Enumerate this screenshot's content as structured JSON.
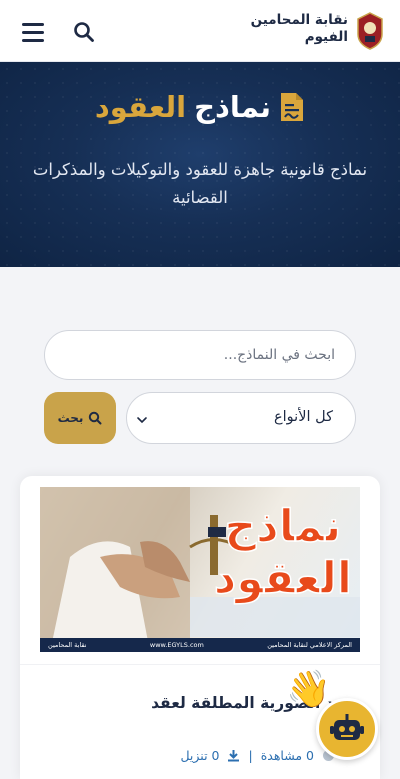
{
  "header": {
    "brand_line1": "نقابة المحامين",
    "brand_line2": "الفيوم"
  },
  "hero": {
    "title_white": "نماذج",
    "title_gold": "العقود",
    "subtitle": "نماذج قانونية جاهزة للعقود والتوكيلات والمذكرات القضائية"
  },
  "search": {
    "placeholder": "ابحث في النماذج...",
    "type_selected": "كل الأنواع",
    "button_label": "بحث"
  },
  "card": {
    "image_title_line1": "نماذج",
    "image_title_line2": "العقود",
    "image_footer_left": "نقابة المحامين",
    "image_footer_center": "www.EGYLS.com",
    "image_footer_right": "المركز الاعلامي لنقابة المحامين",
    "title": "تفيد الصورية المطلقة لعقد",
    "views": "0 مشاهدة",
    "separator": "|",
    "downloads": "0 تنزيل"
  },
  "colors": {
    "navy": "#1e2a44",
    "gold": "#d9a63c",
    "button_gold": "#c9a34a",
    "link_blue": "#2c6fb0"
  }
}
